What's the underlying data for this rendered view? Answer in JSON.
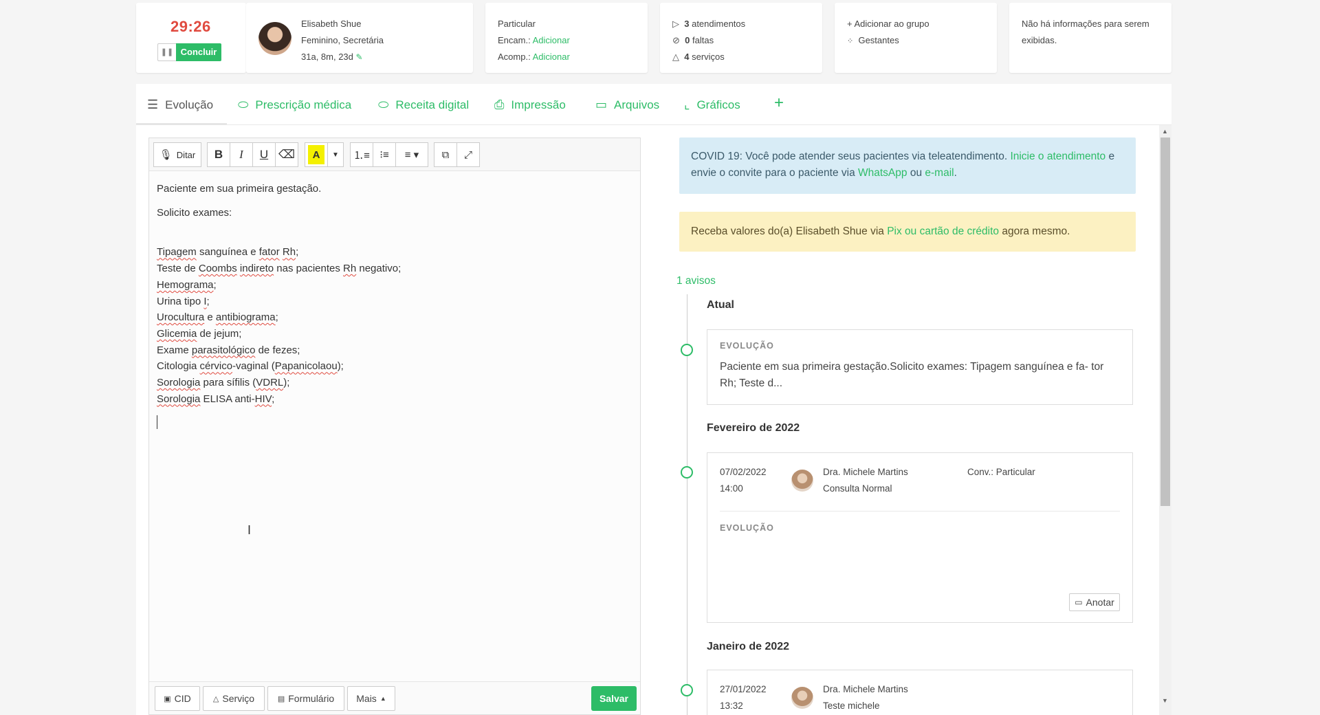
{
  "header": {
    "timer": "29:26",
    "pause_icon": "pause-icon",
    "concluir_label": "Concluir",
    "patient": {
      "name": "Elisabeth Shue",
      "details": "Feminino, Secretária",
      "age": "31a, 8m, 23d"
    },
    "convenio": {
      "type": "Particular",
      "encam_label": "Encam.:",
      "encam_action": "Adicionar",
      "acomp_label": "Acomp.:",
      "acomp_action": "Adicionar"
    },
    "stats": {
      "atendimentos_num": "3",
      "atendimentos_label": "atendimentos",
      "faltas_num": "0",
      "faltas_label": "faltas",
      "servicos_num": "4",
      "servicos_label": "serviços"
    },
    "group": {
      "add_label": "Adicionar ao grupo",
      "group_name": "Gestantes"
    },
    "info": "Não há informações para serem exibidas."
  },
  "tabs": [
    {
      "label": "Evolução",
      "icon": "list-icon"
    },
    {
      "label": "Prescrição médica",
      "icon": "pill-icon"
    },
    {
      "label": "Receita digital",
      "icon": "pill-icon"
    },
    {
      "label": "Impressão",
      "icon": "printer-icon"
    },
    {
      "label": "Arquivos",
      "icon": "folder-icon"
    },
    {
      "label": "Gráficos",
      "icon": "chart-icon"
    },
    {
      "label": "+",
      "icon": "plus-icon"
    }
  ],
  "editor": {
    "ditar_label": "Ditar",
    "highlight_letter": "A",
    "lines": {
      "l1": "Paciente em sua primeira gestação.",
      "l2": "Solicito exames:"
    },
    "footer": {
      "cid": "CID",
      "servico": "Serviço",
      "formulario": "Formulário",
      "mais": "Mais",
      "salvar": "Salvar"
    }
  },
  "right": {
    "covid_text_1": "COVID 19: Você pode atender seus pacientes via teleatendimento. ",
    "covid_link_1": "Inicie o atendimento",
    "covid_text_2": " e envie o convite para o paciente via ",
    "covid_link_2": "WhatsApp",
    "covid_text_3": " ou ",
    "covid_link_3": "e-mail",
    "covid_text_4": ".",
    "pix_text_1": "Receba valores do(a) Elisabeth Shue via ",
    "pix_link": "Pix ou cartão de crédito",
    "pix_text_2": " agora mesmo.",
    "avisos": "1 avisos",
    "current": {
      "heading": "Atual",
      "label": "EVOLUÇÃO",
      "text": "Paciente em sua primeira gestação.Solicito exames: Tipagem sanguínea e fa- tor Rh; Teste d..."
    },
    "feb": {
      "heading": "Fevereiro de 2022",
      "date": "07/02/2022",
      "time": "14:00",
      "doctor": "Dra. Michele Martins",
      "type": "Consulta Normal",
      "conv": "Conv.: Particular",
      "label": "EVOLUÇÃO",
      "anotar": "Anotar"
    },
    "jan": {
      "heading": "Janeiro de 2022",
      "date": "27/01/2022",
      "time": "13:32",
      "doctor": "Dra. Michele Martins",
      "type": "Teste michele"
    }
  },
  "colors": {
    "accent": "#2dbc67",
    "timer": "#e04a3f",
    "info_bg": "#d8ecf6",
    "warn_bg": "#fcf1c2"
  }
}
